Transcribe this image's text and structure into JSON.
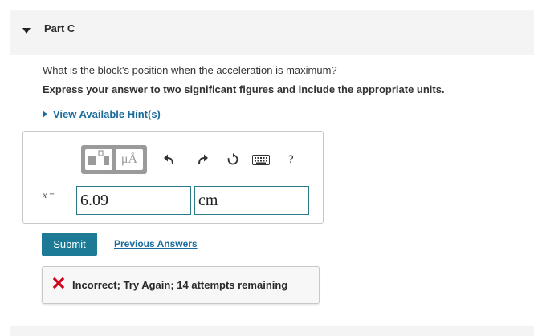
{
  "part": {
    "title": "Part C"
  },
  "question": {
    "prompt": "What is the block's position when the acceleration is maximum?",
    "instruction": "Express your answer to two significant figures and include the appropriate units."
  },
  "hint": {
    "label": "View Available Hint(s)"
  },
  "toolbar": {
    "units_label": "μÅ",
    "help_label": "?"
  },
  "answer": {
    "variable": "x",
    "equals": "=",
    "value": "6.09",
    "unit": "cm"
  },
  "actions": {
    "submit_label": "Submit",
    "previous_answers_label": "Previous Answers"
  },
  "feedback": {
    "message": "Incorrect; Try Again; 14 attempts remaining",
    "status_color": "#d0021b"
  },
  "colors": {
    "accent": "#1c7a96",
    "link": "#1a6c9c",
    "input_border": "#2a7a8a"
  }
}
